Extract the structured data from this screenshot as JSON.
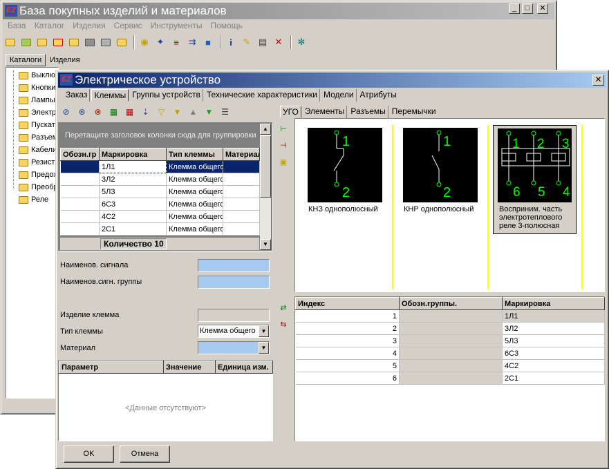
{
  "main_window": {
    "title": "База покупных изделий и материалов",
    "logo_text": "EZ",
    "controls": {
      "minimize": "_",
      "maximize": "□",
      "close": "✕"
    },
    "menu": [
      "База",
      "Каталог",
      "Изделия",
      "Сервис",
      "Инструменты",
      "Помощь"
    ],
    "toolbar_icons": [
      "folder-icon",
      "open-folder-icon",
      "folder-add-icon",
      "folder-delete-icon",
      "folder-up-icon",
      "disk-icon",
      "copy-icon",
      "export-icon",
      "bulb-icon",
      "magnet-icon",
      "add-icon",
      "move-icon",
      "cube-icon",
      "info-icon",
      "pencil-icon",
      "paste-icon",
      "delete-icon",
      "gear-icon"
    ],
    "tabs": [
      "Каталоги",
      "Изделия"
    ],
    "tree_items": [
      "Выклю",
      "Кнопки",
      "Лампы",
      "Электр",
      "Пускат",
      "Разъем",
      "Кабели",
      "Резист",
      "Предох",
      "Преобр",
      "Реле"
    ]
  },
  "dialog": {
    "title": "Электрическое устройство",
    "logo_text": "EZ",
    "close": "✕",
    "tabs": [
      "Заказ",
      "Клеммы",
      "Группы устройств",
      "Технические характеристики",
      "Модели",
      "Атрибуты"
    ],
    "active_tab": "Клеммы",
    "terminal_toolbar_icons": [
      "magnet-add-icon",
      "magnet-add-multi-icon",
      "magnet-delete-icon",
      "rows-add-icon",
      "rows-delete-icon",
      "sort-icon",
      "filter-icon",
      "filter-add-icon",
      "arrow-up-icon",
      "arrow-down-icon",
      "list-icon"
    ],
    "group_hint": "Перетащите заголовок колонки сюда для группировки",
    "terminal_grid": {
      "columns": [
        "Обозн.гр",
        "Маркировка",
        "Тип клеммы",
        "Материал"
      ],
      "rows": [
        {
          "group": "",
          "marking": "1Л1",
          "type": "Клемма общего"
        },
        {
          "group": "",
          "marking": "3Л2",
          "type": "Клемма общего"
        },
        {
          "group": "",
          "marking": "5Л3",
          "type": "Клемма общего"
        },
        {
          "group": "",
          "marking": "6С3",
          "type": "Клемма общего"
        },
        {
          "group": "",
          "marking": "4С2",
          "type": "Клемма общего"
        },
        {
          "group": "",
          "marking": "2С1",
          "type": "Клемма общего"
        }
      ],
      "count_label": "Количество 10"
    },
    "fields": {
      "signal_name": {
        "label": "Наименов. сигнала",
        "value": ""
      },
      "signal_group_name": {
        "label": "Наименов.сигн. группы",
        "value": ""
      },
      "terminal_product": {
        "label": "Изделие клемма",
        "value": ""
      },
      "terminal_type": {
        "label": "Тип клеммы",
        "value": "Клемма общего"
      },
      "material": {
        "label": "Материал",
        "value": ""
      }
    },
    "param_grid": {
      "columns": [
        "Параметр",
        "Значение",
        "Единица изм."
      ],
      "empty_text": "<Данные отсутствуют>"
    },
    "right_tabs": [
      "УГО",
      "Элементы",
      "Разъемы",
      "Перемычки"
    ],
    "active_right_tab": "УГО",
    "ugo_symbols": [
      {
        "caption": "КНЗ однополюсный",
        "pins": [
          "1",
          "2"
        ]
      },
      {
        "caption": "КНР однополюсный",
        "pins": [
          "1",
          "2"
        ]
      },
      {
        "caption": "Восприним. часть электротеплового реле 3-полюсная",
        "pins": [
          "1",
          "2",
          "3",
          "6",
          "5",
          "4"
        ]
      }
    ],
    "mapping_grid": {
      "columns": [
        "Индекс",
        "Обозн.группы.",
        "Маркировка"
      ],
      "rows": [
        {
          "index": "1",
          "group": "",
          "marking": "1Л1"
        },
        {
          "index": "2",
          "group": "",
          "marking": "3Л2"
        },
        {
          "index": "3",
          "group": "",
          "marking": "5Л3"
        },
        {
          "index": "4",
          "group": "",
          "marking": "6С3"
        },
        {
          "index": "5",
          "group": "",
          "marking": "4С2"
        },
        {
          "index": "6",
          "group": "",
          "marking": "2С1"
        }
      ]
    },
    "buttons": {
      "ok": "OK",
      "cancel": "Отмена"
    },
    "colors": {
      "title_active": "#0a246a",
      "selection": "#0a246a",
      "field_highlight": "#a6caf0",
      "symbol_bg": "#000000",
      "symbol_stroke": "#00ff00",
      "marker": "#ffff00"
    }
  }
}
